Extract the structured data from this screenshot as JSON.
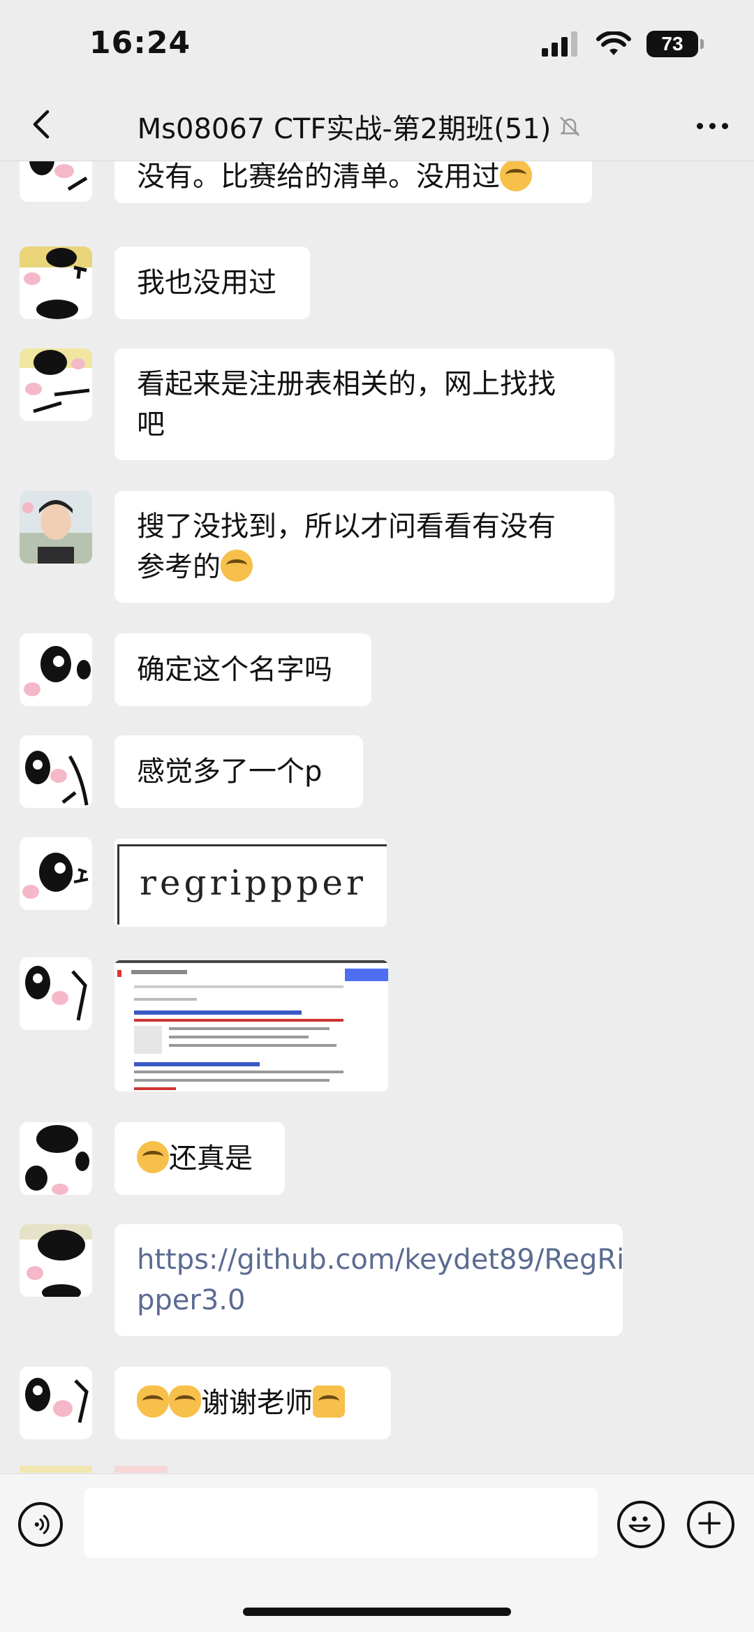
{
  "status_bar": {
    "time": "16:24",
    "battery": "73"
  },
  "nav": {
    "title": "Ms08067 CTF实战-第2期班(51)"
  },
  "messages": [
    {
      "lines": [
        "没有。比赛给的清单。没用过"
      ],
      "trailing_emoji": "face-with-tears-of-joy"
    },
    {
      "lines": [
        "我也没用过"
      ]
    },
    {
      "lines": [
        "看起来是注册表相关的，网上找找",
        "吧"
      ]
    },
    {
      "lines": [
        "搜了没找到，所以才问看看有没有",
        "参考的"
      ],
      "trailing_emoji": "face-with-tears-of-joy"
    },
    {
      "lines": [
        "确定这个名字吗"
      ]
    },
    {
      "lines": [
        "感觉多了一个p"
      ]
    },
    {
      "image_text": "regrippper"
    },
    {
      "image_caption": "search results screenshot"
    },
    {
      "lines": [
        "还真是"
      ],
      "leading_emoji": "face-with-tears-of-joy"
    },
    {
      "lines": [
        "https://github.com/keydet89/RegRi",
        "pper3.0"
      ],
      "is_link": true
    },
    {
      "lines": [
        "谢谢老师"
      ],
      "leading_emojis": [
        "ok-hand",
        "ok-hand"
      ],
      "trailing_emoji": "thumbs-up"
    }
  ],
  "input": {
    "placeholder": ""
  }
}
